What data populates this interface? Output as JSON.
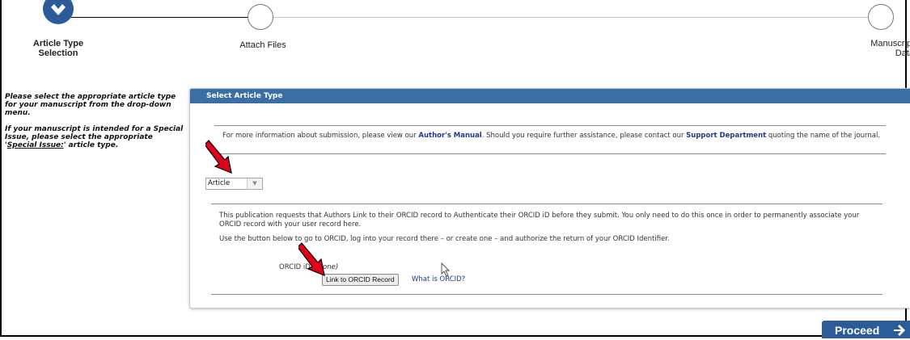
{
  "stepper": {
    "steps": [
      {
        "label": "Article Type Selection",
        "state": "complete"
      },
      {
        "label": "Attach Files",
        "state": "pending"
      },
      {
        "label": "Manuscript Data",
        "state": "pending"
      }
    ],
    "check_icon": "check-icon"
  },
  "instructions": {
    "para1": "Please select the appropriate article type for your manuscript from the drop-down menu.",
    "para2_prefix": "If your manuscript is intended for a Special Issue, please select the appropriate '",
    "para2_link": "Special Issue:",
    "para2_suffix": "' article type."
  },
  "panel": {
    "title": "Select Article Type",
    "info_prefix": "For more information about submission, please view our ",
    "info_link1": "Author's Manual",
    "info_middle": ". Should you require further assistance, please contact our ",
    "info_link2": "Support Department",
    "info_suffix": " quoting the name of the journal."
  },
  "article_type_select": {
    "selected": "Article",
    "arrow_icon": "chevron-down-icon"
  },
  "orcid": {
    "para1": "This publication requests that Authors Link to their ORCID record to Authenticate their ORCID iD before they submit. You only need to do this once in order to permanently associate your ORCID record with your user record here.",
    "para2": "Use the button below to go to ORCID, log into your record there – or create one – and authorize the return of your ORCID Identifier.",
    "id_label": "ORCID iD:",
    "id_value": "(None)",
    "button_label": "Link to ORCID Record",
    "help_link": "What is ORCID?"
  },
  "footer": {
    "proceed_label": "Proceed",
    "proceed_icon": "arrow-right-icon"
  },
  "colors": {
    "accent": "#2b5c99",
    "header": "#3a6ea5",
    "annotation_arrow": "#e0001b"
  }
}
